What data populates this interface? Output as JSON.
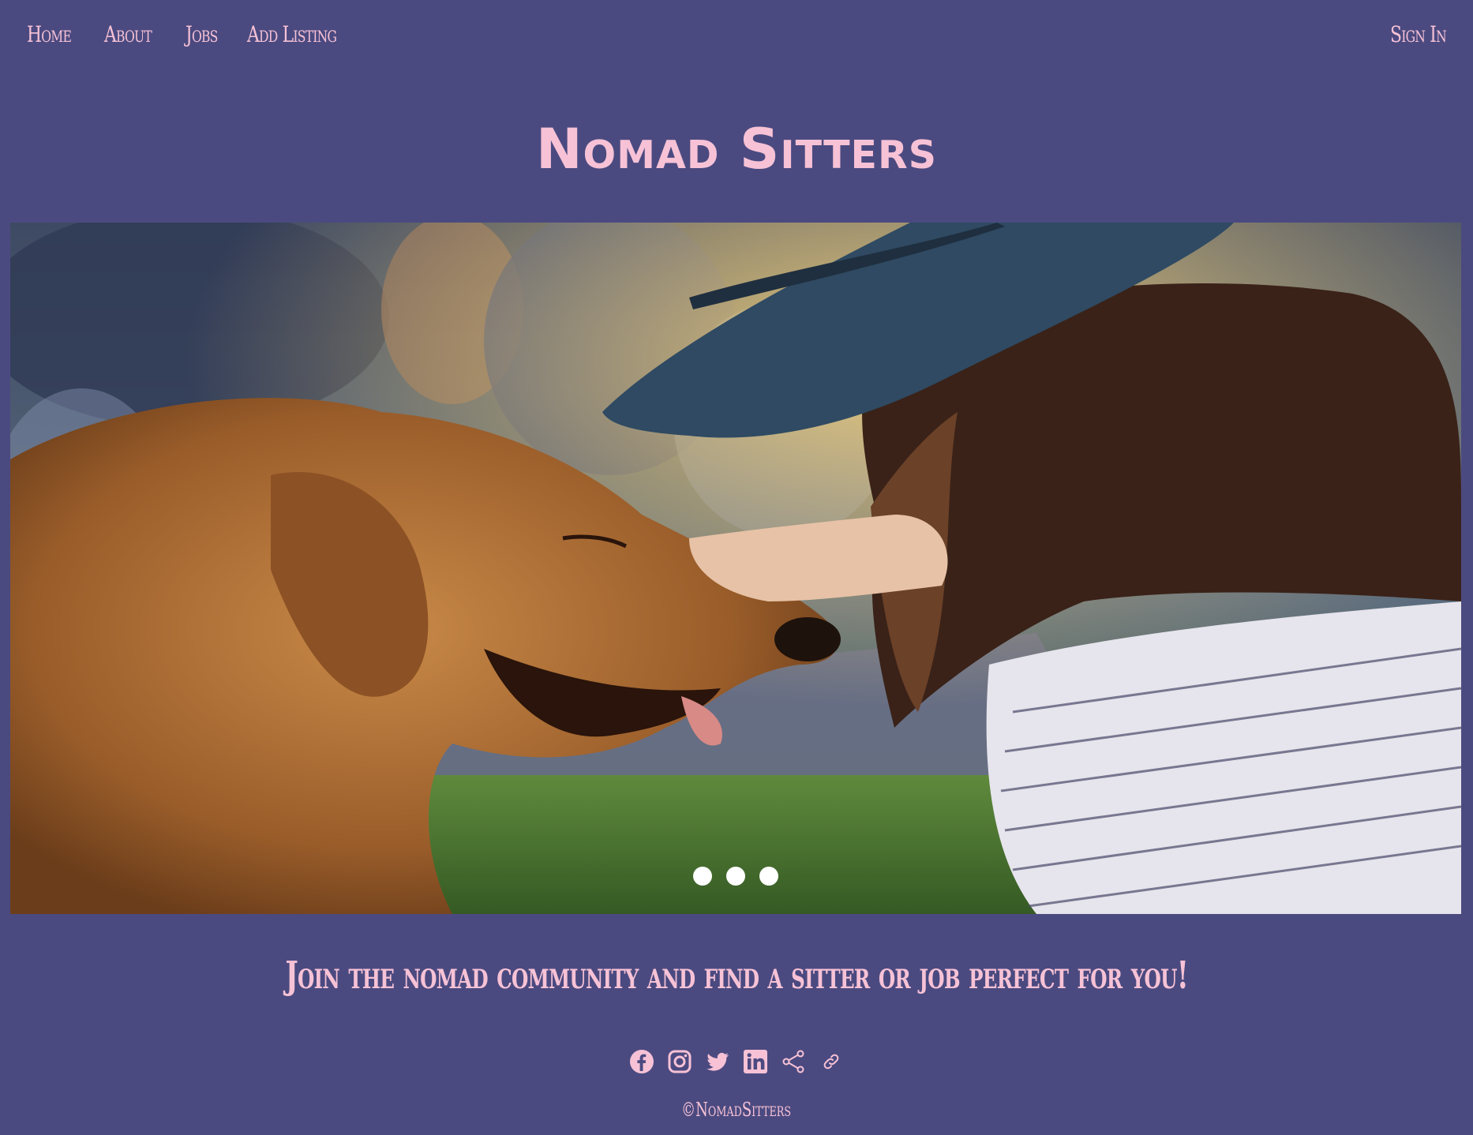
{
  "nav": {
    "links": [
      "Home",
      "About",
      "Jobs",
      "Add Listing"
    ],
    "sign_in": "Sign In"
  },
  "site_title": "Nomad Sitters",
  "hero": {
    "image": "hero-dog-and-woman-photo",
    "slides": 3
  },
  "tagline": "Join the nomad community and find a sitter or job perfect for you!",
  "social": {
    "icons": [
      "facebook-icon",
      "instagram-icon",
      "twitter-icon",
      "linkedin-icon",
      "share-icon",
      "link-icon"
    ]
  },
  "footer": {
    "copyright": "©NomadSitters"
  },
  "colors": {
    "background": "#4b4a80",
    "accent": "#f7c2d6"
  }
}
